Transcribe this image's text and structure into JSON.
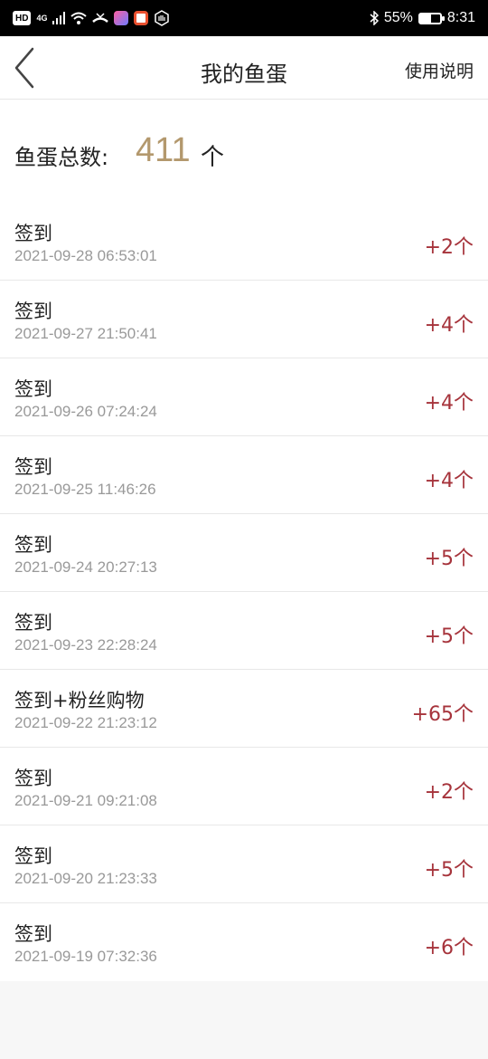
{
  "status_bar": {
    "badges": [
      "HD",
      "4G"
    ],
    "battery": "55%",
    "battery_level": 0.55,
    "time": "8:31"
  },
  "nav": {
    "title": "我的鱼蛋",
    "help_label": "使用说明",
    "back_icon": "chevron-left-icon"
  },
  "summary": {
    "label": "鱼蛋总数:",
    "value": "411",
    "unit": "个"
  },
  "records": [
    {
      "title": "签到",
      "time": "2021-09-28 06:53:01",
      "amount": "+2个"
    },
    {
      "title": "签到",
      "time": "2021-09-27 21:50:41",
      "amount": "+4个"
    },
    {
      "title": "签到",
      "time": "2021-09-26 07:24:24",
      "amount": "+4个"
    },
    {
      "title": "签到",
      "time": "2021-09-25 11:46:26",
      "amount": "+4个"
    },
    {
      "title": "签到",
      "time": "2021-09-24 20:27:13",
      "amount": "+5个"
    },
    {
      "title": "签到",
      "time": "2021-09-23 22:28:24",
      "amount": "+5个"
    },
    {
      "title": "签到+粉丝购物",
      "time": "2021-09-22 21:23:12",
      "amount": "+65个"
    },
    {
      "title": "签到",
      "time": "2021-09-21 09:21:08",
      "amount": "+2个"
    },
    {
      "title": "签到",
      "time": "2021-09-20 21:23:33",
      "amount": "+5个"
    },
    {
      "title": "签到",
      "time": "2021-09-19 07:32:36",
      "amount": "+6个"
    }
  ],
  "colors": {
    "total_value": "#b3986d",
    "amount": "#a6333b"
  }
}
